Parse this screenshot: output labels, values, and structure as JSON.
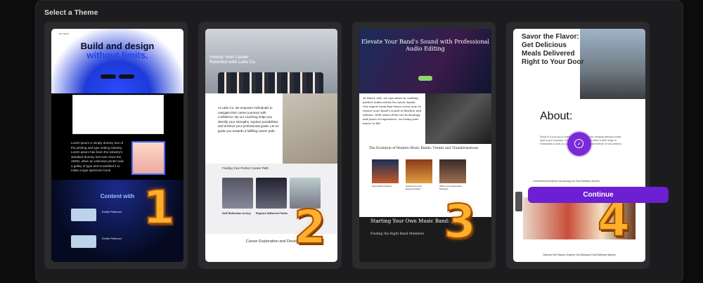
{
  "panel": {
    "title": "Select a Theme"
  },
  "themes": [
    {
      "number": "1",
      "nav": "Your Name",
      "headline_line1": "Build and design",
      "headline_line2": "without limits.",
      "body": "Lorem ipsum is simply dummy text of the printing and type setting industry. Lorem ipsum has been the industry's standard dummy text ever since the 1500s, when an unknown printer took a galley of type and scrambled it to make a type specimen book.",
      "section_title": "Content with",
      "people": [
        "Emilie Petersen",
        "Emilie Petersen"
      ]
    },
    {
      "number": "2",
      "hero_text": "Unlock Your Career Potential with Lobs Co.",
      "body": "At Labs Co. we empower individuals to navigate their career journeys with confidence. By our coaching helps you identify your strengths, explore possibilities, and achieve your professional goals. Let us guide you towards a fulfilling career path.",
      "section_title": "Finding Your Perfect Career Path",
      "captions": [
        "Self Reflection is Key",
        "Explore Different Fields"
      ],
      "bottom_title": "Career Exploration and Devel"
    },
    {
      "number": "3",
      "headline": "Elevate Your Band's Sound with Professional Audio Editing",
      "body": "At Music Lab, we specialize in crafting perfect audio tracks for music bands. Our expert team fine-tunes every note to ensure your band's sound is flawless and vibrant. With state-of-the-art technology and years of experience, we bring your music to life.",
      "section_title": "The Evolution of Modern Music Bands: Trends and Transformations",
      "captions": [
        "Sound Right Patterns",
        "Global and Local Experimentation",
        "Offline and Independent Releases"
      ],
      "dark_title": "Starting Your Own Music Band: A Co",
      "dark_sub": "Finding the Right Band Members"
    },
    {
      "number": "4",
      "headline": "Savor the Flavor: Get Delicious Meals Delivered Right to Your Door",
      "about": "About:",
      "body": "ShopGo is your go-to online food delivery service, bringing delicious meals right to your doorstep. Conveniently, our service offers a wide range of restaurants so that you can enjoy the ultimate convenience of food delivery.",
      "convenience": "Convenient and Quick: Introducing our Food Delivery Service",
      "discover": "Discover the Flavors: Explore Our Delicious Food Delivery Options"
    }
  ],
  "actions": {
    "continue_label": "Continue"
  },
  "colors": {
    "accent": "#6d1fd3",
    "number_fill": "#ffb02a"
  }
}
